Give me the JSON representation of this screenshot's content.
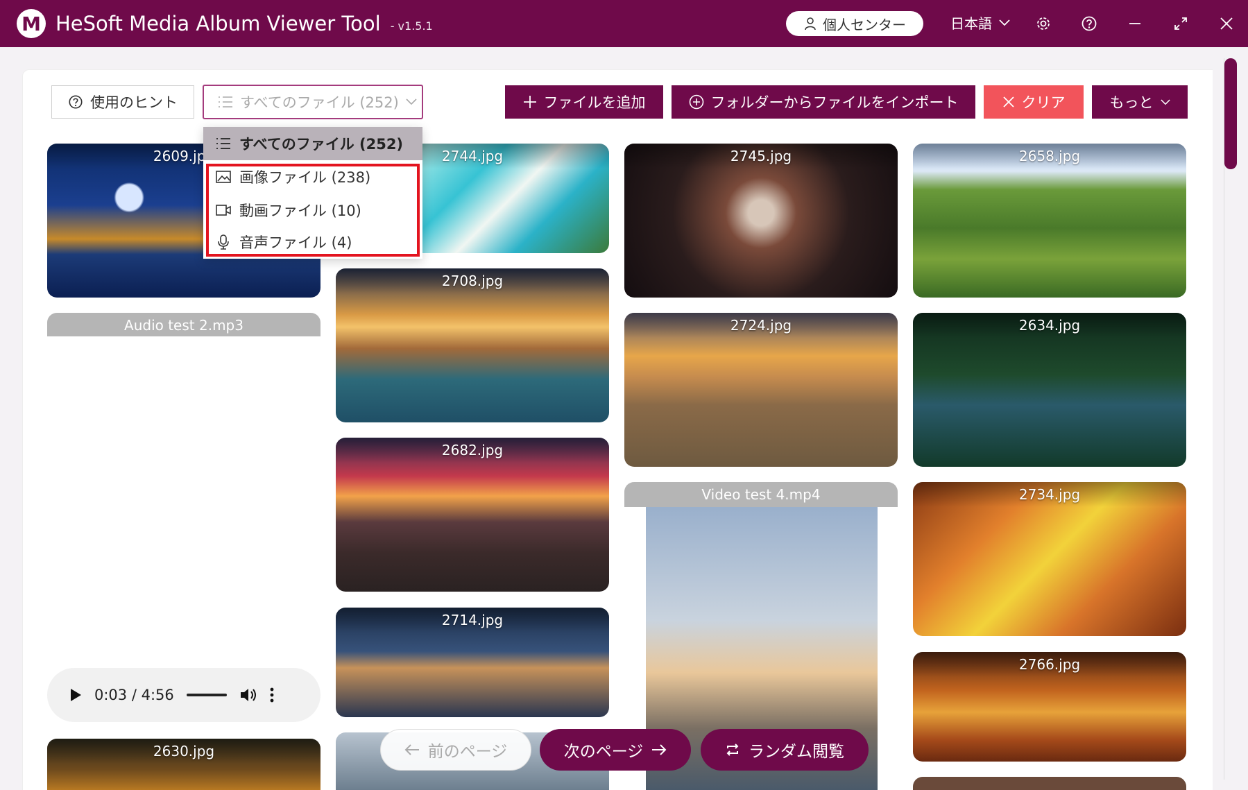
{
  "window": {
    "logo_letter": "M",
    "title": "HeSoft Media Album Viewer Tool",
    "version": "- v1.5.1",
    "profile_label": "個人センター",
    "language": "日本語"
  },
  "toolbar": {
    "hint_label": "使用のヒント",
    "filter_selected": "すべてのファイル (252)",
    "add_files_label": "ファイルを追加",
    "import_folder_label": "フォルダーからファイルをインポート",
    "clear_label": "クリア",
    "more_label": "もっと"
  },
  "filter_menu": {
    "items": [
      {
        "label": "すべてのファイル (252)",
        "icon": "list-icon"
      },
      {
        "label": "画像ファイル (238)",
        "icon": "image-icon"
      },
      {
        "label": "動画ファイル (10)",
        "icon": "video-icon"
      },
      {
        "label": "音声ファイル (4)",
        "icon": "microphone-icon"
      }
    ]
  },
  "gallery": [
    {
      "name": "2609.jpg"
    },
    {
      "name": "Audio test 2.mp3"
    },
    {
      "name": "2630.jpg"
    },
    {
      "name": "2744.jpg"
    },
    {
      "name": "2708.jpg"
    },
    {
      "name": "2682.jpg"
    },
    {
      "name": "2714.jpg"
    },
    {
      "name": "2745.jpg"
    },
    {
      "name": "2724.jpg"
    },
    {
      "name": "Video test 4.mp4"
    },
    {
      "name": "2658.jpg"
    },
    {
      "name": "2634.jpg"
    },
    {
      "name": "2734.jpg"
    },
    {
      "name": "2766.jpg"
    }
  ],
  "audio_player": {
    "time": "0:03 / 4:56"
  },
  "pagination": {
    "prev_label": "前のページ",
    "next_label": "次のページ",
    "random_label": "ランダム閲覧"
  },
  "colors": {
    "brand": "#6f0a4a",
    "danger": "#f2545b",
    "highlight": "#e3141f"
  }
}
